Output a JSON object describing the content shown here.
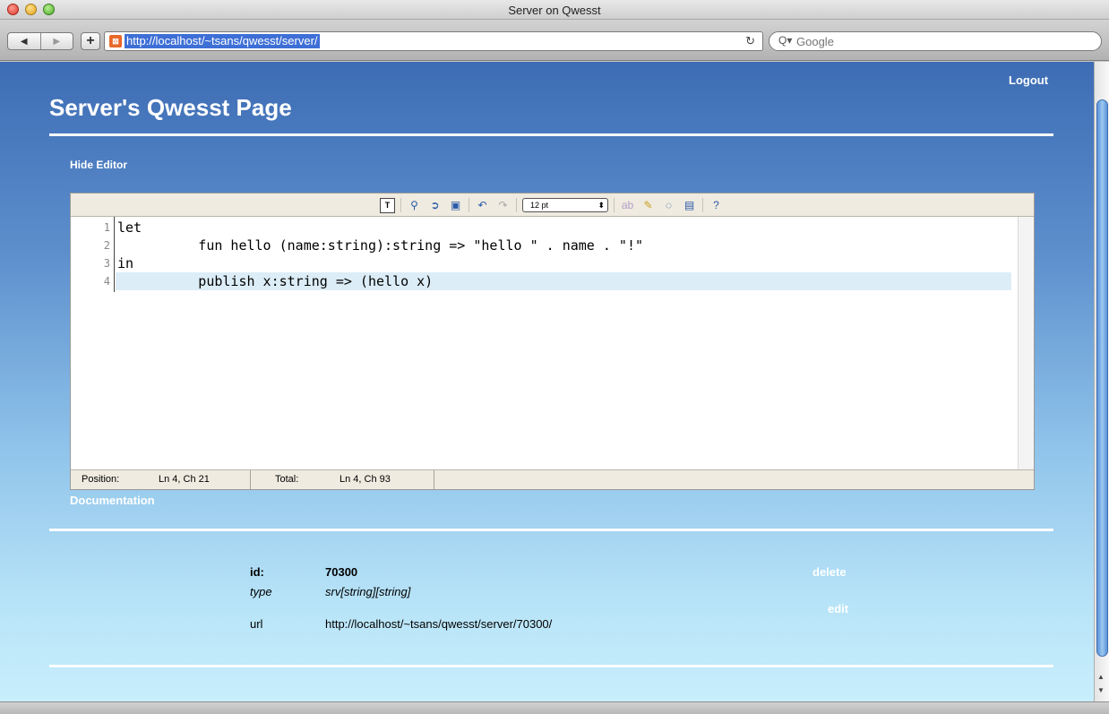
{
  "window": {
    "title": "Server on Qwesst"
  },
  "toolbar": {
    "back_icon": "back-icon",
    "forward_icon": "forward-icon",
    "add_label": "+",
    "url": "http://localhost/~tsans/qwesst/server/",
    "search_placeholder": "Google"
  },
  "page": {
    "logout": "Logout",
    "title": "Server's Qwesst Page",
    "hide_editor": "Hide Editor",
    "documentation": "Documentation"
  },
  "editor": {
    "font_size": "12 pt",
    "line_numbers": [
      "1",
      "2",
      "3",
      "4"
    ],
    "lines": [
      "let",
      "          fun hello (name:string):string => \"hello \" . name . \"!\"",
      "in",
      "          publish x:string => (hello x)"
    ],
    "status": {
      "position_label": "Position:",
      "position_value": "Ln 4, Ch 21",
      "total_label": "Total:",
      "total_value": "Ln 4, Ch 93"
    }
  },
  "info": {
    "id_label": "id:",
    "id_value": "70300",
    "type_label": "type",
    "type_value": "srv[string][string]",
    "url_label": "url",
    "url_value": "http://localhost/~tsans/qwesst/server/70300/",
    "delete": "delete",
    "edit": "edit"
  }
}
